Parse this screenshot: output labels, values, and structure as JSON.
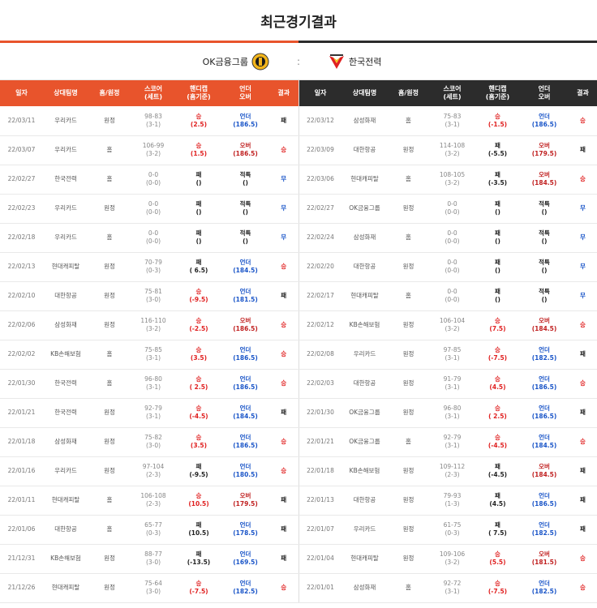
{
  "title": "최근경기결과",
  "team_left": "OK금융그룹",
  "team_right": "한국전력",
  "vs": ":",
  "colors": {
    "accent": "#e8542c",
    "dark": "#2c2c2c",
    "win": "#e02020",
    "under": "#1a55c8"
  },
  "headers": [
    "일자",
    "상대팀명",
    "홈/원정",
    "스코어 (세트)",
    "핸디캡 (홈기준)",
    "언더 오버",
    "결과"
  ],
  "left_rows": [
    {
      "date": "22/03/11",
      "opp": "우리카드",
      "ha": "원정",
      "score": "98-83",
      "sets": "(3-1)",
      "hc": "승",
      "hcv": "(2.5)",
      "ou": "언더",
      "ouv": "(186.5)",
      "res": "패"
    },
    {
      "date": "22/03/07",
      "opp": "우리카드",
      "ha": "홈",
      "score": "106-99",
      "sets": "(3-2)",
      "hc": "승",
      "hcv": "(1.5)",
      "ou": "오버",
      "ouv": "(186.5)",
      "res": "승"
    },
    {
      "date": "22/02/27",
      "opp": "한국전력",
      "ha": "홈",
      "score": "0-0",
      "sets": "(0-0)",
      "hc": "패",
      "hcv": "()",
      "ou": "적특",
      "ouv": "()",
      "res": "무"
    },
    {
      "date": "22/02/23",
      "opp": "우리카드",
      "ha": "원정",
      "score": "0-0",
      "sets": "(0-0)",
      "hc": "패",
      "hcv": "()",
      "ou": "적특",
      "ouv": "()",
      "res": "무"
    },
    {
      "date": "22/02/18",
      "opp": "우리카드",
      "ha": "홈",
      "score": "0-0",
      "sets": "(0-0)",
      "hc": "패",
      "hcv": "()",
      "ou": "적특",
      "ouv": "()",
      "res": "무"
    },
    {
      "date": "22/02/13",
      "opp": "현대캐피탈",
      "ha": "원정",
      "score": "70-79",
      "sets": "(0-3)",
      "hc": "패",
      "hcv": "( 6.5)",
      "ou": "언더",
      "ouv": "(184.5)",
      "res": "승"
    },
    {
      "date": "22/02/10",
      "opp": "대한항공",
      "ha": "원정",
      "score": "75-81",
      "sets": "(3-0)",
      "hc": "승",
      "hcv": "(-9.5)",
      "ou": "언더",
      "ouv": "(181.5)",
      "res": "패"
    },
    {
      "date": "22/02/06",
      "opp": "삼성화재",
      "ha": "원정",
      "score": "116-110",
      "sets": "(3-2)",
      "hc": "승",
      "hcv": "(-2.5)",
      "ou": "오버",
      "ouv": "(186.5)",
      "res": "승"
    },
    {
      "date": "22/02/02",
      "opp": "KB손해보험",
      "ha": "홈",
      "score": "75-85",
      "sets": "(3-1)",
      "hc": "승",
      "hcv": "(3.5)",
      "ou": "언더",
      "ouv": "(186.5)",
      "res": "승"
    },
    {
      "date": "22/01/30",
      "opp": "한국전력",
      "ha": "홈",
      "score": "96-80",
      "sets": "(3-1)",
      "hc": "승",
      "hcv": "( 2.5)",
      "ou": "언더",
      "ouv": "(186.5)",
      "res": "승"
    },
    {
      "date": "22/01/21",
      "opp": "한국전력",
      "ha": "원정",
      "score": "92-79",
      "sets": "(3-1)",
      "hc": "승",
      "hcv": "(-4.5)",
      "ou": "언더",
      "ouv": "(184.5)",
      "res": "패"
    },
    {
      "date": "22/01/18",
      "opp": "삼성화재",
      "ha": "원정",
      "score": "75-82",
      "sets": "(3-0)",
      "hc": "승",
      "hcv": "(3.5)",
      "ou": "언더",
      "ouv": "(186.5)",
      "res": "승"
    },
    {
      "date": "22/01/16",
      "opp": "우리카드",
      "ha": "원정",
      "score": "97-104",
      "sets": "(2-3)",
      "hc": "패",
      "hcv": "(-9.5)",
      "ou": "언더",
      "ouv": "(180.5)",
      "res": "승"
    },
    {
      "date": "22/01/11",
      "opp": "현대캐피탈",
      "ha": "홈",
      "score": "106-108",
      "sets": "(2-3)",
      "hc": "승",
      "hcv": "(10.5)",
      "ou": "오버",
      "ouv": "(179.5)",
      "res": "패"
    },
    {
      "date": "22/01/06",
      "opp": "대한항공",
      "ha": "홈",
      "score": "65-77",
      "sets": "(0-3)",
      "hc": "패",
      "hcv": "(10.5)",
      "ou": "언더",
      "ouv": "(178.5)",
      "res": "패"
    },
    {
      "date": "21/12/31",
      "opp": "KB손해보험",
      "ha": "원정",
      "score": "88-77",
      "sets": "(3-0)",
      "hc": "패",
      "hcv": "(-13.5)",
      "ou": "언더",
      "ouv": "(169.5)",
      "res": "패"
    },
    {
      "date": "21/12/26",
      "opp": "현대캐피탈",
      "ha": "원정",
      "score": "75-64",
      "sets": "(3-0)",
      "hc": "승",
      "hcv": "(-7.5)",
      "ou": "언더",
      "ouv": "(182.5)",
      "res": "승"
    }
  ],
  "right_rows": [
    {
      "date": "22/03/12",
      "opp": "삼성화재",
      "ha": "홈",
      "score": "75-83",
      "sets": "(3-1)",
      "hc": "승",
      "hcv": "(-1.5)",
      "ou": "언더",
      "ouv": "(186.5)",
      "res": "승"
    },
    {
      "date": "22/03/09",
      "opp": "대한항공",
      "ha": "원정",
      "score": "114-108",
      "sets": "(3-2)",
      "hc": "패",
      "hcv": "(-5.5)",
      "ou": "오버",
      "ouv": "(179.5)",
      "res": "패"
    },
    {
      "date": "22/03/06",
      "opp": "현대캐피탈",
      "ha": "홈",
      "score": "108-105",
      "sets": "(3-2)",
      "hc": "패",
      "hcv": "(-3.5)",
      "ou": "오버",
      "ouv": "(184.5)",
      "res": "승"
    },
    {
      "date": "22/02/27",
      "opp": "OK금융그룹",
      "ha": "원정",
      "score": "0-0",
      "sets": "(0-0)",
      "hc": "패",
      "hcv": "()",
      "ou": "적특",
      "ouv": "()",
      "res": "무"
    },
    {
      "date": "22/02/24",
      "opp": "삼성화재",
      "ha": "홈",
      "score": "0-0",
      "sets": "(0-0)",
      "hc": "패",
      "hcv": "()",
      "ou": "적특",
      "ouv": "()",
      "res": "무"
    },
    {
      "date": "22/02/20",
      "opp": "대한항공",
      "ha": "원정",
      "score": "0-0",
      "sets": "(0-0)",
      "hc": "패",
      "hcv": "()",
      "ou": "적특",
      "ouv": "()",
      "res": "무"
    },
    {
      "date": "22/02/17",
      "opp": "현대캐피탈",
      "ha": "홈",
      "score": "0-0",
      "sets": "(0-0)",
      "hc": "패",
      "hcv": "()",
      "ou": "적특",
      "ouv": "()",
      "res": "무"
    },
    {
      "date": "22/02/12",
      "opp": "KB손해보험",
      "ha": "원정",
      "score": "106-104",
      "sets": "(3-2)",
      "hc": "승",
      "hcv": "(7.5)",
      "ou": "오버",
      "ouv": "(184.5)",
      "res": "승"
    },
    {
      "date": "22/02/08",
      "opp": "우리카드",
      "ha": "원정",
      "score": "97-85",
      "sets": "(3-1)",
      "hc": "승",
      "hcv": "(-7.5)",
      "ou": "언더",
      "ouv": "(182.5)",
      "res": "패"
    },
    {
      "date": "22/02/03",
      "opp": "대한항공",
      "ha": "원정",
      "score": "91-79",
      "sets": "(3-1)",
      "hc": "승",
      "hcv": "(4.5)",
      "ou": "언더",
      "ouv": "(186.5)",
      "res": "승"
    },
    {
      "date": "22/01/30",
      "opp": "OK금융그룹",
      "ha": "원정",
      "score": "96-80",
      "sets": "(3-1)",
      "hc": "승",
      "hcv": "( 2.5)",
      "ou": "언더",
      "ouv": "(186.5)",
      "res": "패"
    },
    {
      "date": "22/01/21",
      "opp": "OK금융그룹",
      "ha": "홈",
      "score": "92-79",
      "sets": "(3-1)",
      "hc": "승",
      "hcv": "(-4.5)",
      "ou": "언더",
      "ouv": "(184.5)",
      "res": "승"
    },
    {
      "date": "22/01/18",
      "opp": "KB손해보험",
      "ha": "원정",
      "score": "109-112",
      "sets": "(2-3)",
      "hc": "패",
      "hcv": "(-4.5)",
      "ou": "오버",
      "ouv": "(184.5)",
      "res": "패"
    },
    {
      "date": "22/01/13",
      "opp": "대한항공",
      "ha": "원정",
      "score": "79-93",
      "sets": "(1-3)",
      "hc": "패",
      "hcv": "(4.5)",
      "ou": "언더",
      "ouv": "(186.5)",
      "res": "패"
    },
    {
      "date": "22/01/07",
      "opp": "우리카드",
      "ha": "원정",
      "score": "61-75",
      "sets": "(0-3)",
      "hc": "패",
      "hcv": "( 7.5)",
      "ou": "언더",
      "ouv": "(182.5)",
      "res": "패"
    },
    {
      "date": "22/01/04",
      "opp": "현대캐피탈",
      "ha": "원정",
      "score": "109-106",
      "sets": "(3-2)",
      "hc": "승",
      "hcv": "(5.5)",
      "ou": "오버",
      "ouv": "(181.5)",
      "res": "승"
    },
    {
      "date": "22/01/01",
      "opp": "삼성화재",
      "ha": "홈",
      "score": "92-72",
      "sets": "(3-1)",
      "hc": "승",
      "hcv": "(-7.5)",
      "ou": "언더",
      "ouv": "(182.5)",
      "res": "승"
    }
  ]
}
